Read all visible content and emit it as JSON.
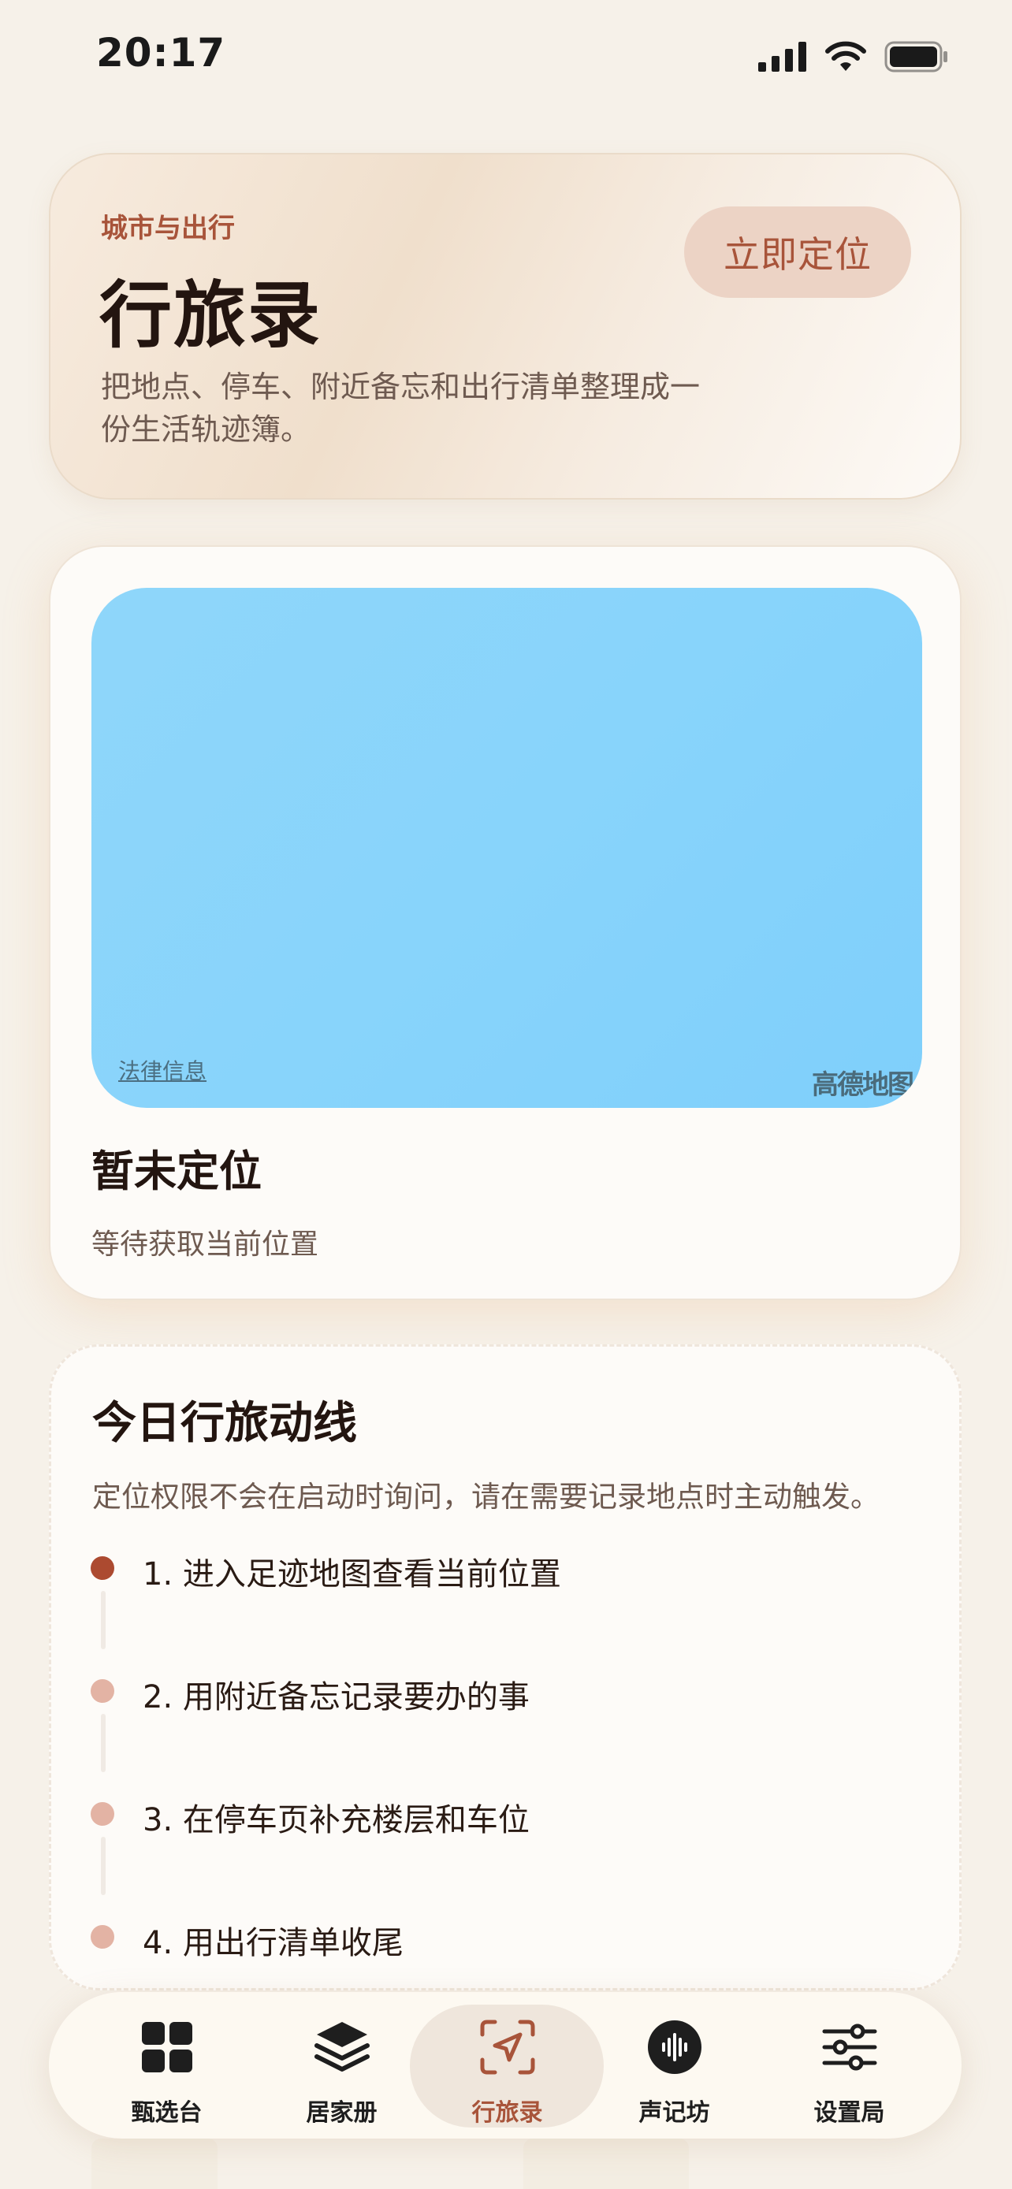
{
  "status_bar": {
    "time": "20:17"
  },
  "header": {
    "eyebrow": "城市与出行",
    "title": "行旅录",
    "subtitle": "把地点、停车、附近备忘和出行清单整理成一份生活轨迹簿。",
    "locate_button": "立即定位"
  },
  "map_card": {
    "legal_link": "法律信息",
    "map_provider": "高德地图",
    "location_title": "暂未定位",
    "location_status": "等待获取当前位置"
  },
  "route_card": {
    "title": "今日行旅动线",
    "description": "定位权限不会在启动时询问，请在需要记录地点时主动触发。",
    "steps": [
      {
        "label": "1. 进入足迹地图查看当前位置"
      },
      {
        "label": "2. 用附近备忘记录要办的事"
      },
      {
        "label": "3. 在停车页补充楼层和车位"
      },
      {
        "label": "4. 用出行清单收尾"
      }
    ]
  },
  "tab_bar": {
    "items": [
      {
        "label": "甄选台",
        "icon": "grid-icon"
      },
      {
        "label": "居家册",
        "icon": "layers-icon"
      },
      {
        "label": "行旅录",
        "icon": "navigation-arrow-icon",
        "active": true
      },
      {
        "label": "声记坊",
        "icon": "sound-wave-icon"
      },
      {
        "label": "设置局",
        "icon": "sliders-icon"
      }
    ]
  },
  "colors": {
    "accent": "#a8543a",
    "background": "#f6f1e9",
    "map_water": "#88d4fb"
  }
}
